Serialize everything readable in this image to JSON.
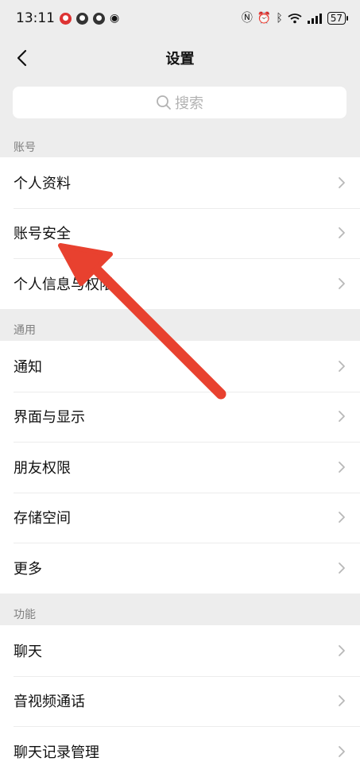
{
  "status_bar": {
    "time": "13:11",
    "battery": "57"
  },
  "nav": {
    "title": "设置"
  },
  "search": {
    "placeholder": "搜索"
  },
  "sections": [
    {
      "label": "账号",
      "items": [
        "个人资料",
        "账号安全",
        "个人信息与权限"
      ]
    },
    {
      "label": "通用",
      "items": [
        "通知",
        "界面与显示",
        "朋友权限",
        "存储空间",
        "更多"
      ]
    },
    {
      "label": "功能",
      "items": [
        "聊天",
        "音视频通话",
        "聊天记录管理"
      ]
    }
  ],
  "colors": {
    "background": "#ededed",
    "annotation_arrow": "#e8412f",
    "secondary_text": "#7f7f7f"
  }
}
